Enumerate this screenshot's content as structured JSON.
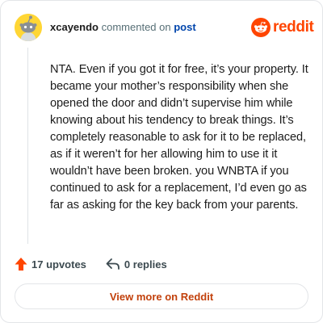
{
  "header": {
    "username": "xcayendo",
    "commented_text": "commented on",
    "post_link": "post"
  },
  "brand": {
    "wordmark": "reddit",
    "color": "#ff4500",
    "icon": "reddit-alien-icon"
  },
  "avatar": {
    "icon": "snoo-avatar-icon",
    "background": "#ffd635"
  },
  "comment": {
    "body": "NTA. Even if you got it for free, it’s your property. It became your mother’s responsibility when she opened the door and didn’t supervise him while knowing about his tendency to break things. It’s completely reasonable to ask for it to be replaced, as if it weren’t for her allowing him to use it it wouldn’t have been broken. you WNBTA if you continued to ask for a replacement, I’d even go as far as asking for the key back from your parents."
  },
  "actions": {
    "upvotes_label": "17 upvotes",
    "upvote_icon": "upvote-arrow-icon",
    "upvote_color": "#ff4500",
    "replies_label": "0 replies",
    "reply_icon": "reply-arrow-icon"
  },
  "footer": {
    "view_more_label": "View more on Reddit",
    "view_more_color": "#c2410c"
  }
}
